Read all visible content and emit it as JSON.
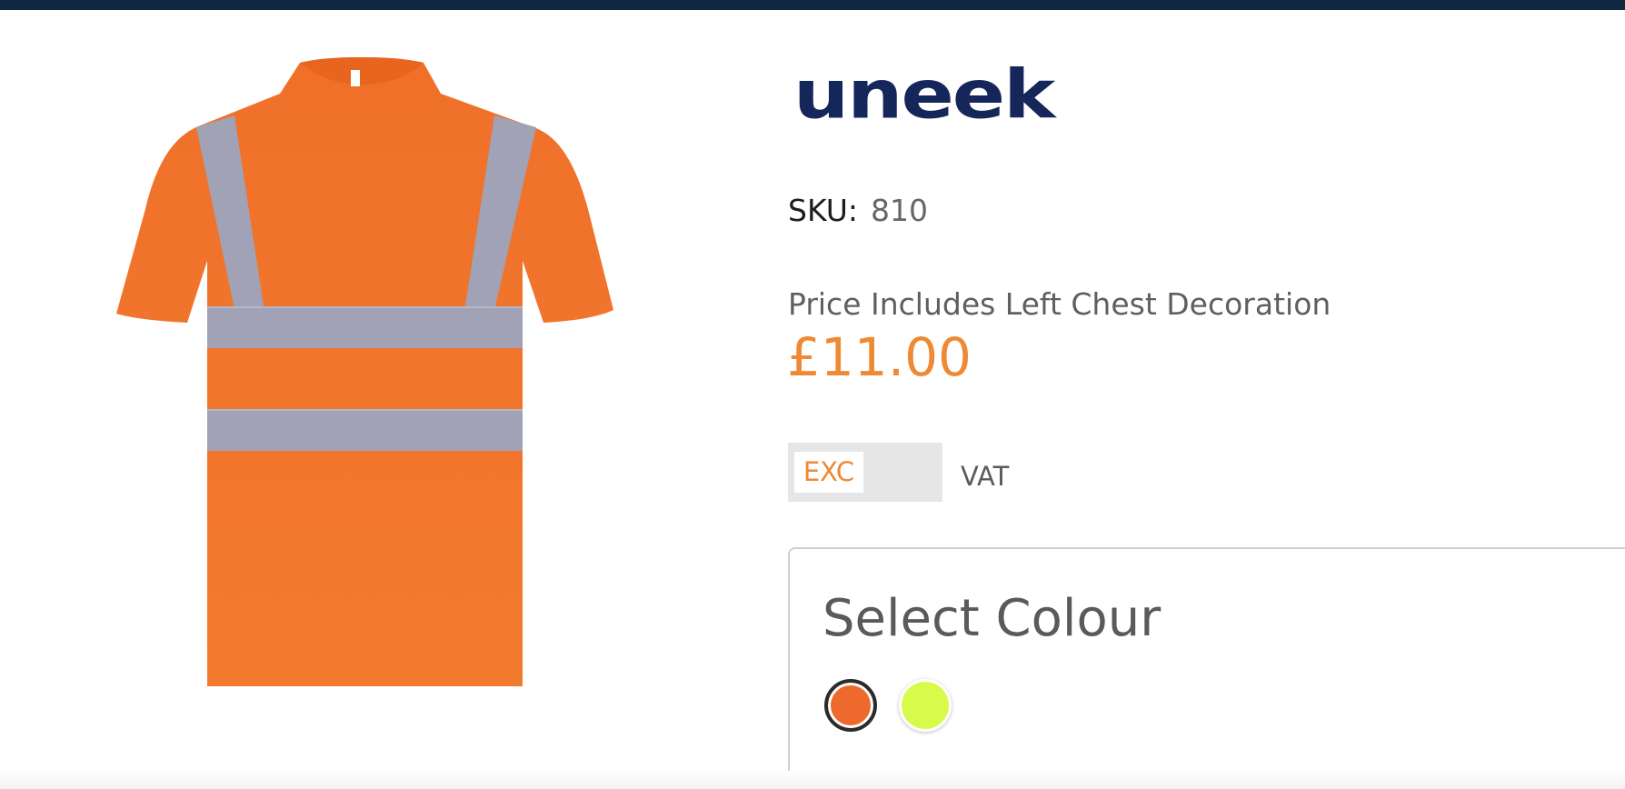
{
  "brand": {
    "name": "uneek",
    "color": "#14265a"
  },
  "header": {
    "bar_color": "#0f2741"
  },
  "product": {
    "image_icon": "hi-vis-tshirt-orange-image",
    "sku_label": "SKU:",
    "sku_value": "810",
    "price_note": "Price Includes Left Chest Decoration",
    "price": "£11.00",
    "price_color": "#ee8a35"
  },
  "vat_toggle": {
    "selected_option": "EXC",
    "label": "VAT"
  },
  "colour_selector": {
    "title": "Select Colour",
    "swatches": [
      {
        "color": "#ee6a2c",
        "selected": true
      },
      {
        "color": "#d8fb4b",
        "selected": false
      }
    ]
  }
}
